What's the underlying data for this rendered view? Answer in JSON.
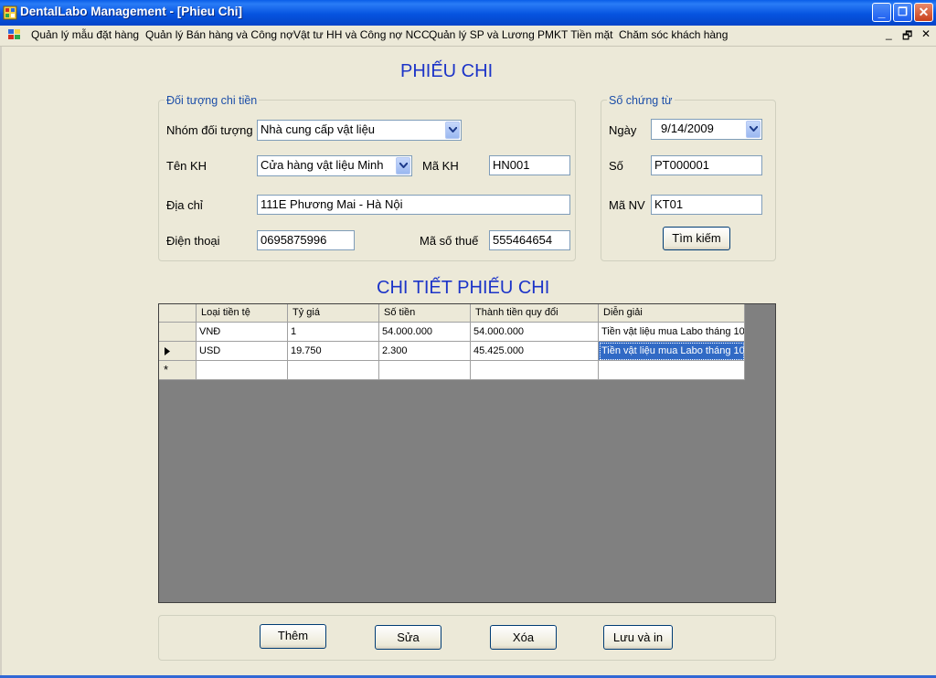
{
  "window": {
    "title": "DentalLabo Management - [Phieu Chi]",
    "minimize_glyph": "_",
    "restore_glyph": "❐",
    "close_glyph": "✕"
  },
  "menu": {
    "items": [
      {
        "label": "Quản lý mẫu đặt hàng"
      },
      {
        "label": "Quản lý Bán hàng và Công nợ"
      },
      {
        "label": "Vật tư HH và Công nợ NCC"
      },
      {
        "label": "Quản lý SP và Lương"
      },
      {
        "label": "PMKT Tiền mặt"
      },
      {
        "label": "Chăm sóc khách hàng"
      }
    ],
    "mdi_minimize": "_",
    "mdi_restore": "🗗",
    "mdi_close": "✕"
  },
  "form": {
    "heading": "PHIẾU CHI",
    "payee_group": {
      "legend": "Đối tượng chi tiền",
      "group_label": "Nhóm đối tượng",
      "group_value": "Nhà cung cấp vật liệu",
      "customer_label": "Tên KH",
      "customer_value": "Cửa hàng vật liệu Minh",
      "code_label": "Mã KH",
      "code_value": "HN001",
      "address_label": "Địa chỉ",
      "address_value": "111E Phương Mai - Hà Nội",
      "phone_label": "Điện thoại",
      "phone_value": "0695875996",
      "tax_label": "Mã số thuế",
      "tax_value": "555464654"
    },
    "voucher_group": {
      "legend": "Số chứng từ",
      "date_label": "Ngày",
      "date_value": "9/14/2009",
      "number_label": "Số",
      "number_value": "PT000001",
      "employee_label": "Mã NV",
      "employee_value": "KT01",
      "search_button": "Tìm kiếm"
    },
    "detail_heading": "CHI TIẾT PHIẾU CHI",
    "grid": {
      "columns": [
        "Loại tiền tệ",
        "Tỷ giá",
        "Số tiền",
        "Thành tiền quy đổi",
        "Diễn giải"
      ],
      "rows": [
        [
          "VNĐ",
          "1",
          "54.000.000",
          "54.000.000",
          "Tiền vật liệu mua Labo tháng 10"
        ],
        [
          "USD",
          "19.750",
          "2.300",
          "45.425.000",
          "Tiền vật liệu mua Labo tháng 10"
        ]
      ],
      "new_row_marker": "*",
      "selection_color": "#316ac5"
    },
    "buttons": {
      "add": "Thêm",
      "edit": "Sửa",
      "delete": "Xóa",
      "save_print": "Lưu và in"
    }
  },
  "colors": {
    "heading": "#1c34c8",
    "legend": "#1c4ea8",
    "titlebar": "#0654e0"
  }
}
